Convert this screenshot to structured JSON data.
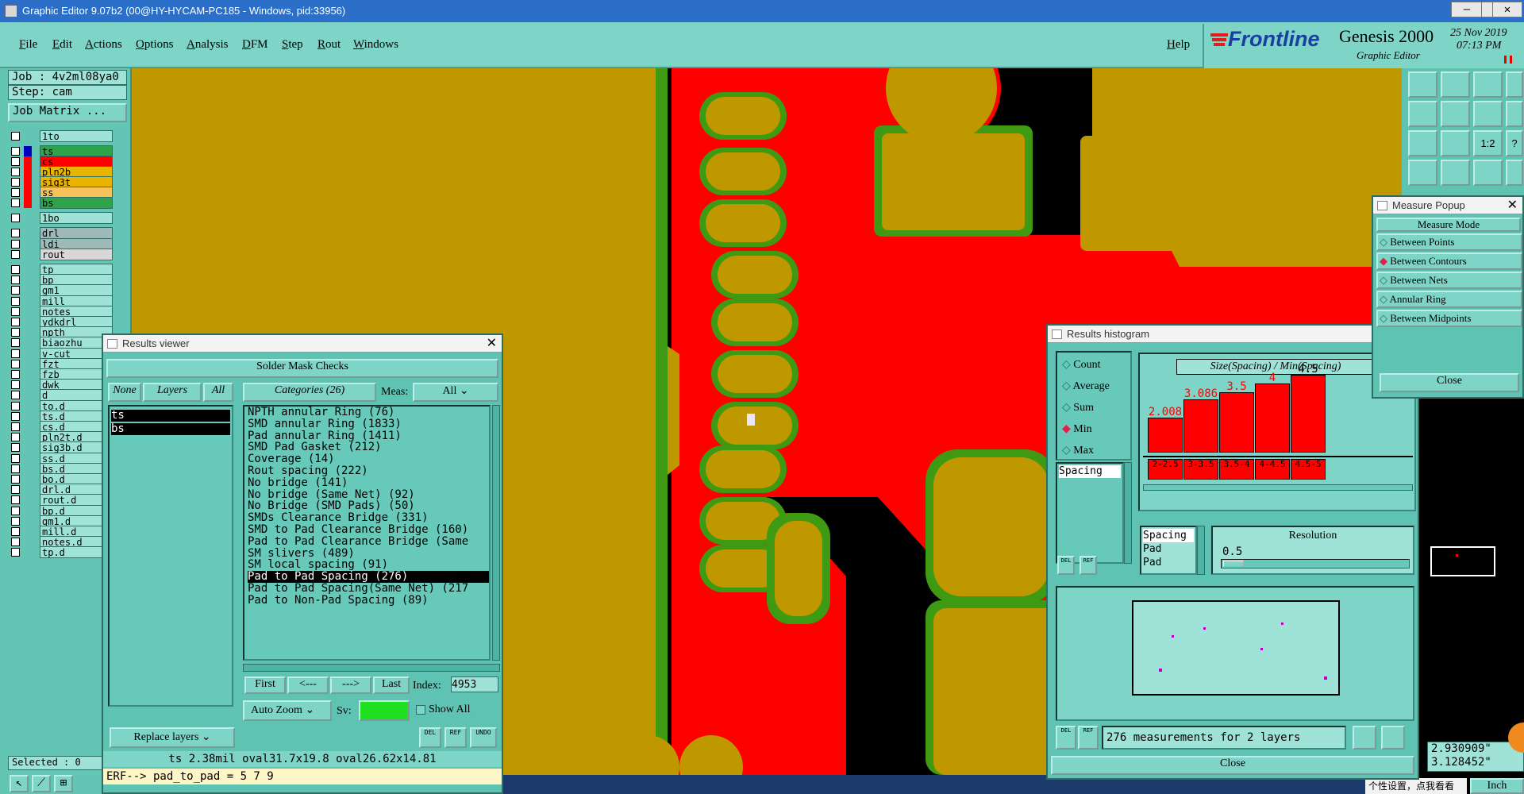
{
  "window": {
    "title": "Graphic Editor 9.07b2 (00@HY-HYCAM-PC185 - Windows, pid:33956)"
  },
  "menu": {
    "items": [
      "File",
      "Edit",
      "Actions",
      "Options",
      "Analysis",
      "DFM",
      "Step",
      "Rout",
      "Windows"
    ],
    "help": "Help"
  },
  "brand": {
    "logo": "Frontline",
    "product": "Genesis 2000",
    "subtitle": "Graphic Editor",
    "date": "25 Nov 2019",
    "time": "07:13 PM"
  },
  "job": {
    "job_label": "Job : 4v2ml08ya0",
    "step_label": "Step: cam",
    "matrix_button": "Job Matrix ..."
  },
  "layers": [
    {
      "name": "1to",
      "color": "#9fe3d8",
      "group": 0
    },
    {
      "name": "ts",
      "color": "#2fa34a",
      "group": 1
    },
    {
      "name": "cs",
      "color": "#ff0000",
      "group": 1
    },
    {
      "name": "pln2b",
      "color": "#e8b400",
      "group": 1
    },
    {
      "name": "sig3t",
      "color": "#e8b400",
      "group": 1
    },
    {
      "name": "ss",
      "color": "#f5c35a",
      "group": 1
    },
    {
      "name": "bs",
      "color": "#2fa34a",
      "group": 1
    },
    {
      "name": "1bo",
      "color": "#9fe3d8",
      "group": 2
    },
    {
      "name": "drl",
      "color": "#9fb8b8",
      "group": 3
    },
    {
      "name": "ldi",
      "color": "#9fb8b8",
      "group": 3
    },
    {
      "name": "rout",
      "color": "#d8d8d8",
      "group": 3
    },
    {
      "name": "tp",
      "color": "#9fe3d8",
      "group": 4
    },
    {
      "name": "bp",
      "color": "#9fe3d8",
      "group": 4
    },
    {
      "name": "gm1",
      "color": "#9fe3d8",
      "group": 4
    },
    {
      "name": "mill",
      "color": "#9fe3d8",
      "group": 4
    },
    {
      "name": "notes",
      "color": "#9fe3d8",
      "group": 4
    },
    {
      "name": "ydkdrl",
      "color": "#9fe3d8",
      "group": 4
    },
    {
      "name": "npth",
      "color": "#9fe3d8",
      "group": 4
    },
    {
      "name": "biaozhu",
      "color": "#9fe3d8",
      "group": 4
    },
    {
      "name": "v-cut",
      "color": "#9fe3d8",
      "group": 4
    },
    {
      "name": "fzt",
      "color": "#9fe3d8",
      "group": 4
    },
    {
      "name": "fzb",
      "color": "#9fe3d8",
      "group": 4
    },
    {
      "name": "dwk",
      "color": "#9fe3d8",
      "group": 4
    },
    {
      "name": "d",
      "color": "#9fe3d8",
      "group": 4
    },
    {
      "name": "to.d",
      "color": "#9fe3d8",
      "group": 4
    },
    {
      "name": "ts.d",
      "color": "#9fe3d8",
      "group": 4
    },
    {
      "name": "cs.d",
      "color": "#9fe3d8",
      "group": 4
    },
    {
      "name": "pln2t.d",
      "color": "#9fe3d8",
      "group": 4
    },
    {
      "name": "sig3b.d",
      "color": "#9fe3d8",
      "group": 4
    },
    {
      "name": "ss.d",
      "color": "#9fe3d8",
      "group": 4
    },
    {
      "name": "bs.d",
      "color": "#9fe3d8",
      "group": 4
    },
    {
      "name": "bo.d",
      "color": "#9fe3d8",
      "group": 4
    },
    {
      "name": "drl.d",
      "color": "#9fe3d8",
      "group": 4
    },
    {
      "name": "rout.d",
      "color": "#9fe3d8",
      "group": 4
    },
    {
      "name": "bp.d",
      "color": "#9fe3d8",
      "group": 4
    },
    {
      "name": "gm1.d",
      "color": "#9fe3d8",
      "group": 4
    },
    {
      "name": "mill.d",
      "color": "#9fe3d8",
      "group": 4
    },
    {
      "name": "notes.d",
      "color": "#9fe3d8",
      "group": 4
    },
    {
      "name": "tp.d",
      "color": "#9fe3d8",
      "group": 4
    }
  ],
  "status": {
    "selected": "Selected : 0",
    "unit": "Inch",
    "coord_x": "2.930909\"",
    "coord_y": "3.128452\"",
    "tray": "个性设置，点我看看"
  },
  "results_viewer": {
    "title": "Results viewer",
    "header": "Solder Mask Checks",
    "none": "None",
    "layers": "Layers",
    "all": "All",
    "categories": "Categories (26)",
    "meas_label": "Meas:",
    "meas_value": "All",
    "layer_list": [
      "ts",
      "bs"
    ],
    "items": [
      "NPTH annular Ring (76)",
      "SMD annular Ring (1833)",
      "Pad annular Ring (1411)",
      "SMD Pad Gasket (212)",
      "Coverage (14)",
      "Rout spacing (222)",
      "No bridge (141)",
      "No bridge (Same Net) (92)",
      "No Bridge (SMD Pads) (50)",
      "SMDs Clearance Bridge (331)",
      "SMD to Pad Clearance Bridge (160)",
      "Pad to Pad Clearance Bridge (Same",
      "SM slivers (489)",
      "SM local spacing (91)",
      "Pad to Pad Spacing (276)",
      "Pad to Pad Spacing(Same Net) (217",
      "Pad to Non-Pad Spacing (89)"
    ],
    "selected_item": 14,
    "first": "First",
    "prev": "<---",
    "next": "--->",
    "last": "Last",
    "index_label": "Index:",
    "index_value": "4953",
    "auto_zoom": "Auto Zoom",
    "sv": "Sv:",
    "show_all": "Show All",
    "replace_layers": "Replace layers",
    "del": "DEL",
    "ref": "REF",
    "undo": "UNDO",
    "info": "ts 2.38mil   oval31.7x19.8   oval26.62x14.81",
    "erf": "ERF--> pad_to_pad = 5 7 9"
  },
  "histogram": {
    "title": "Results histogram",
    "modes": [
      "Count",
      "Average",
      "Sum",
      "Min",
      "Max"
    ],
    "selected_mode": 3,
    "side_list": [
      "Spacing"
    ],
    "detail_list": [
      "Spacing",
      "Pad",
      "Pad"
    ],
    "resolution_label": "Resolution",
    "resolution_value": "0.5",
    "measurements": "276 measurements for 2 layers",
    "close": "Close",
    "del": "DEL",
    "ref": "REF"
  },
  "chart_data": {
    "type": "bar",
    "title": "Size(Spacing) / Min(Spacing)",
    "categories": [
      "2-2.5",
      "3-3.5",
      "3.5-4",
      "4-4.5",
      "4.5-5"
    ],
    "values": [
      2.008,
      3.086,
      3.5,
      4,
      4.5
    ],
    "value_labels": [
      "2.008",
      "3.086",
      "3.5",
      "4",
      "4.5"
    ],
    "ylim": [
      0,
      4.6
    ],
    "bar_color": "#ff0000",
    "value_label_color": "#ff0000"
  },
  "measure_popup": {
    "title": "Measure Popup",
    "header": "Measure Mode",
    "options": [
      "Between Points",
      "Between Contours",
      "Between Nets",
      "Annular Ring",
      "Between Midpoints"
    ],
    "selected": 1,
    "close": "Close"
  },
  "colors": {
    "accent": "#7fd4c8",
    "panel": "#5ec3b2",
    "copper": "#bf9800",
    "mask": "#ff0000",
    "ring": "#3f9a13"
  }
}
